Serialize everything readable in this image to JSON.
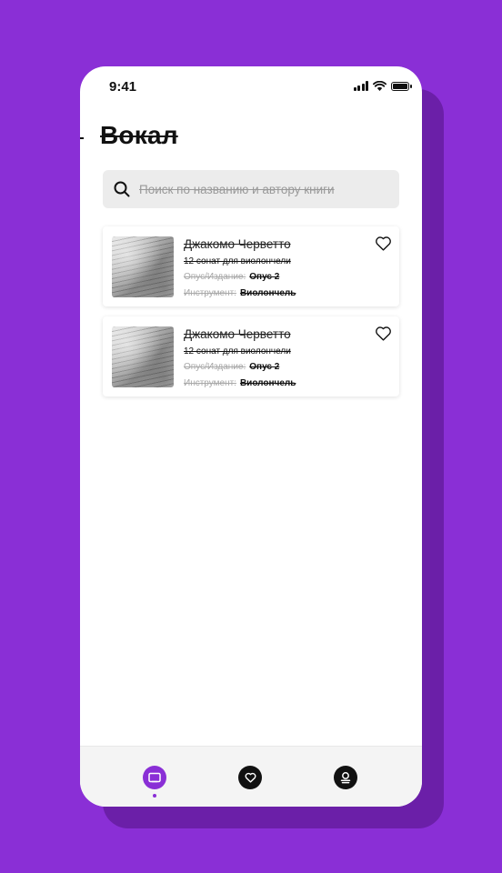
{
  "status_bar": {
    "time": "9:41"
  },
  "header": {
    "title": "Вокал"
  },
  "search": {
    "placeholder": "Поиск по названию и автору книги"
  },
  "cards": [
    {
      "author": "Джакомо Черветто",
      "work": "12 сонат для виолончели",
      "opus_label": "Опус/Издание:",
      "opus_value": "Опус 2",
      "instrument_label": "Инструмент:",
      "instrument_value": "Виолончель",
      "favorite_icon": "heart-outline"
    },
    {
      "author": "Джакомо Черветто",
      "work": "12 сонат для виолончели",
      "opus_label": "Опус/Издание:",
      "opus_value": "Опус 2",
      "instrument_label": "Инструмент:",
      "instrument_value": "Виолончель",
      "favorite_icon": "heart-outline"
    }
  ],
  "bottom_nav": {
    "items": [
      {
        "icon": "book-icon",
        "active": true
      },
      {
        "icon": "heart-icon",
        "active": false
      },
      {
        "icon": "user-icon",
        "active": false
      }
    ]
  },
  "colors": {
    "accent": "#8a2fd6",
    "background": "#8a2fd6",
    "shadow": "#6b1fa8",
    "text": "#111111",
    "muted": "#a8a8a8"
  }
}
